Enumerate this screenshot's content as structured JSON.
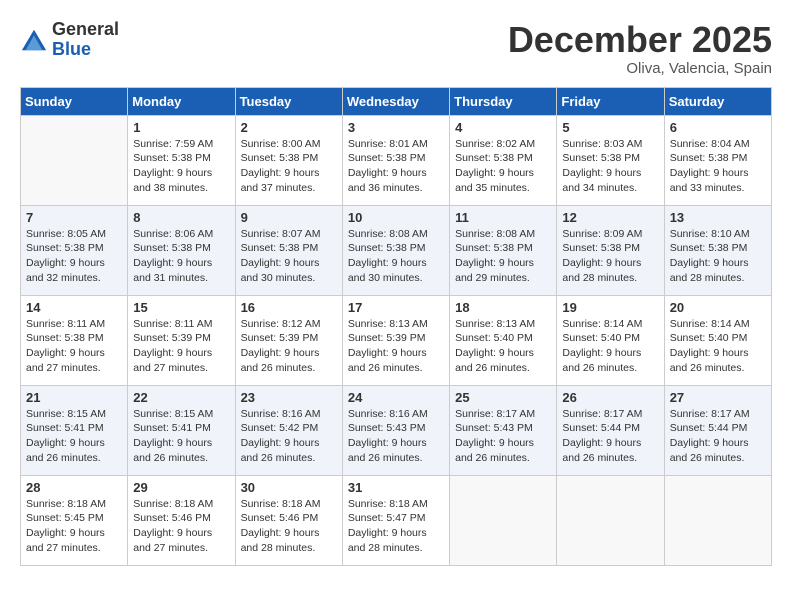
{
  "header": {
    "logo": {
      "general": "General",
      "blue": "Blue"
    },
    "title": "December 2025",
    "location": "Oliva, Valencia, Spain"
  },
  "calendar": {
    "days_of_week": [
      "Sunday",
      "Monday",
      "Tuesday",
      "Wednesday",
      "Thursday",
      "Friday",
      "Saturday"
    ],
    "weeks": [
      [
        {
          "day": null,
          "info": null
        },
        {
          "day": "1",
          "sunrise": "7:59 AM",
          "sunset": "5:38 PM",
          "daylight": "9 hours and 38 minutes."
        },
        {
          "day": "2",
          "sunrise": "8:00 AM",
          "sunset": "5:38 PM",
          "daylight": "9 hours and 37 minutes."
        },
        {
          "day": "3",
          "sunrise": "8:01 AM",
          "sunset": "5:38 PM",
          "daylight": "9 hours and 36 minutes."
        },
        {
          "day": "4",
          "sunrise": "8:02 AM",
          "sunset": "5:38 PM",
          "daylight": "9 hours and 35 minutes."
        },
        {
          "day": "5",
          "sunrise": "8:03 AM",
          "sunset": "5:38 PM",
          "daylight": "9 hours and 34 minutes."
        },
        {
          "day": "6",
          "sunrise": "8:04 AM",
          "sunset": "5:38 PM",
          "daylight": "9 hours and 33 minutes."
        }
      ],
      [
        {
          "day": "7",
          "sunrise": "8:05 AM",
          "sunset": "5:38 PM",
          "daylight": "9 hours and 32 minutes."
        },
        {
          "day": "8",
          "sunrise": "8:06 AM",
          "sunset": "5:38 PM",
          "daylight": "9 hours and 31 minutes."
        },
        {
          "day": "9",
          "sunrise": "8:07 AM",
          "sunset": "5:38 PM",
          "daylight": "9 hours and 30 minutes."
        },
        {
          "day": "10",
          "sunrise": "8:08 AM",
          "sunset": "5:38 PM",
          "daylight": "9 hours and 30 minutes."
        },
        {
          "day": "11",
          "sunrise": "8:08 AM",
          "sunset": "5:38 PM",
          "daylight": "9 hours and 29 minutes."
        },
        {
          "day": "12",
          "sunrise": "8:09 AM",
          "sunset": "5:38 PM",
          "daylight": "9 hours and 28 minutes."
        },
        {
          "day": "13",
          "sunrise": "8:10 AM",
          "sunset": "5:38 PM",
          "daylight": "9 hours and 28 minutes."
        }
      ],
      [
        {
          "day": "14",
          "sunrise": "8:11 AM",
          "sunset": "5:38 PM",
          "daylight": "9 hours and 27 minutes."
        },
        {
          "day": "15",
          "sunrise": "8:11 AM",
          "sunset": "5:39 PM",
          "daylight": "9 hours and 27 minutes."
        },
        {
          "day": "16",
          "sunrise": "8:12 AM",
          "sunset": "5:39 PM",
          "daylight": "9 hours and 26 minutes."
        },
        {
          "day": "17",
          "sunrise": "8:13 AM",
          "sunset": "5:39 PM",
          "daylight": "9 hours and 26 minutes."
        },
        {
          "day": "18",
          "sunrise": "8:13 AM",
          "sunset": "5:40 PM",
          "daylight": "9 hours and 26 minutes."
        },
        {
          "day": "19",
          "sunrise": "8:14 AM",
          "sunset": "5:40 PM",
          "daylight": "9 hours and 26 minutes."
        },
        {
          "day": "20",
          "sunrise": "8:14 AM",
          "sunset": "5:40 PM",
          "daylight": "9 hours and 26 minutes."
        }
      ],
      [
        {
          "day": "21",
          "sunrise": "8:15 AM",
          "sunset": "5:41 PM",
          "daylight": "9 hours and 26 minutes."
        },
        {
          "day": "22",
          "sunrise": "8:15 AM",
          "sunset": "5:41 PM",
          "daylight": "9 hours and 26 minutes."
        },
        {
          "day": "23",
          "sunrise": "8:16 AM",
          "sunset": "5:42 PM",
          "daylight": "9 hours and 26 minutes."
        },
        {
          "day": "24",
          "sunrise": "8:16 AM",
          "sunset": "5:43 PM",
          "daylight": "9 hours and 26 minutes."
        },
        {
          "day": "25",
          "sunrise": "8:17 AM",
          "sunset": "5:43 PM",
          "daylight": "9 hours and 26 minutes."
        },
        {
          "day": "26",
          "sunrise": "8:17 AM",
          "sunset": "5:44 PM",
          "daylight": "9 hours and 26 minutes."
        },
        {
          "day": "27",
          "sunrise": "8:17 AM",
          "sunset": "5:44 PM",
          "daylight": "9 hours and 26 minutes."
        }
      ],
      [
        {
          "day": "28",
          "sunrise": "8:18 AM",
          "sunset": "5:45 PM",
          "daylight": "9 hours and 27 minutes."
        },
        {
          "day": "29",
          "sunrise": "8:18 AM",
          "sunset": "5:46 PM",
          "daylight": "9 hours and 27 minutes."
        },
        {
          "day": "30",
          "sunrise": "8:18 AM",
          "sunset": "5:46 PM",
          "daylight": "9 hours and 28 minutes."
        },
        {
          "day": "31",
          "sunrise": "8:18 AM",
          "sunset": "5:47 PM",
          "daylight": "9 hours and 28 minutes."
        },
        {
          "day": null,
          "info": null
        },
        {
          "day": null,
          "info": null
        },
        {
          "day": null,
          "info": null
        }
      ]
    ]
  }
}
